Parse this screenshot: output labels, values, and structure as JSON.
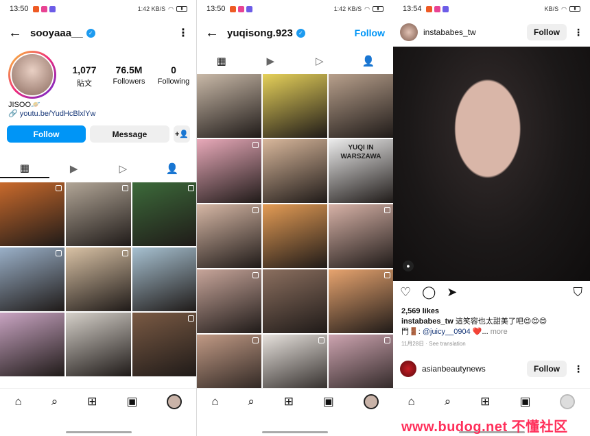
{
  "panel1": {
    "status": {
      "time": "13:50",
      "right": "1:42 KB/S"
    },
    "header": {
      "username": "sooyaaa__",
      "more": "⋮"
    },
    "stats": [
      {
        "value": "1,077",
        "label": "貼文"
      },
      {
        "value": "76.5M",
        "label": "Followers"
      },
      {
        "value": "0",
        "label": "Following"
      }
    ],
    "bio": {
      "name": "JISOO🪐",
      "link": "youtu.be/YudHcBlxlYw"
    },
    "buttons": {
      "follow": "Follow",
      "message": "Message",
      "add": "+👤"
    },
    "tabs": [
      "▦",
      "▶",
      "▷",
      "👤"
    ],
    "tiles": [
      "#c96a2c",
      "#b2a697",
      "#3c6a3a",
      "#9ab0c8",
      "#d9c2a5",
      "#a7c1d1",
      "#c9a4c2",
      "#d5d0c9",
      "#7a5a44"
    ]
  },
  "panel2": {
    "status": {
      "time": "13:50",
      "right": "1:42 KB/S"
    },
    "header": {
      "username": "yuqisong.923",
      "follow": "Follow"
    },
    "tabs": [
      "▦",
      "▶",
      "▷",
      "👤"
    ],
    "tiles": [
      "#c9b9a8",
      "#e6d15a",
      "#b8a08c",
      "#e8a9b9",
      "#d8b79b",
      "#ececec",
      "#d6b7a5",
      "#e49c55",
      "#d7b2a7",
      "#c7a59a",
      "#8b6f5f",
      "#e7a46f",
      "#c19a85",
      "#e6e1dc",
      "#cda4b0"
    ],
    "tile_texts": {
      "t6": "YUQI IN WARSZAWA"
    }
  },
  "panel3": {
    "status": {
      "time": "13:54",
      "right": "KB/S"
    },
    "post": {
      "user": "instababes_tw",
      "follow": "Follow",
      "likes": "2,569 likes",
      "caption_user": "instababes_tw",
      "caption_text": "這笑容也太甜美了吧😍😍😍",
      "caption_line2_prefix": "門🚪:",
      "mention": "@juicy__0904",
      "caption_line2_suffix": "❤️... ",
      "more": "more",
      "date": "11月28日 · See translation"
    },
    "post2": {
      "user": "asianbeautynews",
      "follow": "Follow"
    }
  },
  "nav": [
    "⌂",
    "⌕",
    "⊞",
    "▣"
  ],
  "watermark": "www.budog.net 不懂社区"
}
